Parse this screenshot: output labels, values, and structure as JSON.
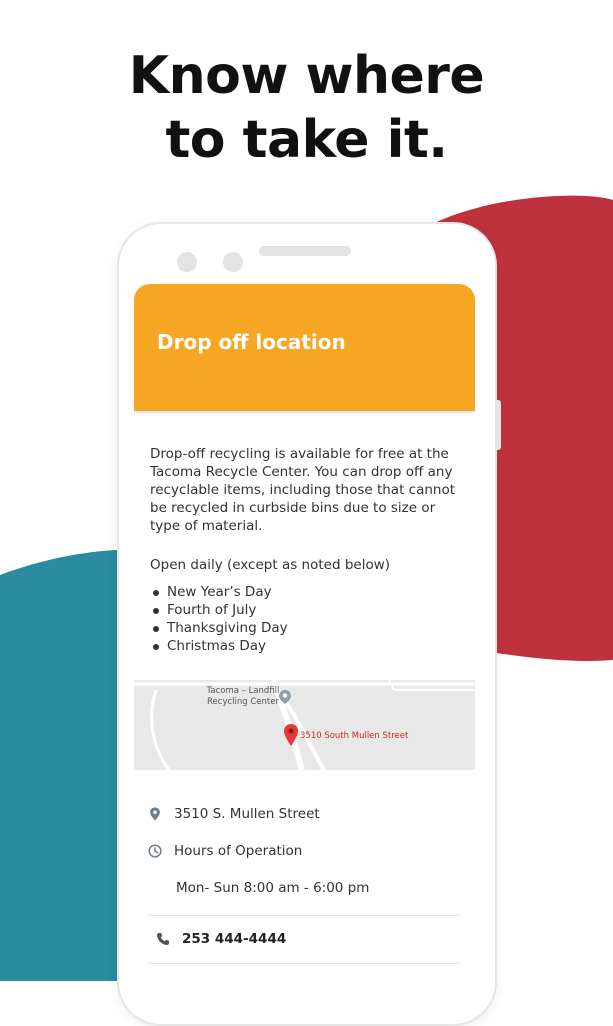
{
  "headline": {
    "line1": "Know where",
    "line2": "to take it."
  },
  "colors": {
    "accent_orange": "#f5a623",
    "blob_red": "#c0313e",
    "blob_teal": "#2a8c9e"
  },
  "screen": {
    "title": "Drop off location",
    "description": "Drop-off recycling is available for free at the Tacoma Recycle Center. You can drop off any recyclable items, including those that cannot be recycled in curbside bins due to size or type of material.",
    "open_note": "Open daily (except as noted below)",
    "holidays": [
      "New Year’s Day",
      "Fourth of July",
      "Thanksgiving Day",
      "Christmas Day"
    ],
    "map": {
      "poi_label": "Tacoma – Landfill Recycling Center",
      "pin_label": "3510 South Mullen Street"
    },
    "address": "3510 S. Mullen Street",
    "hours_label": "Hours of Operation",
    "hours_value": "Mon- Sun  8:00 am - 6:00 pm",
    "phone": "253 444-4444"
  },
  "icons": {
    "address": "location-pin-icon",
    "hours": "clock-icon",
    "phone": "phone-icon",
    "map_pin": "map-marker-icon",
    "poi": "poi-marker-icon"
  }
}
